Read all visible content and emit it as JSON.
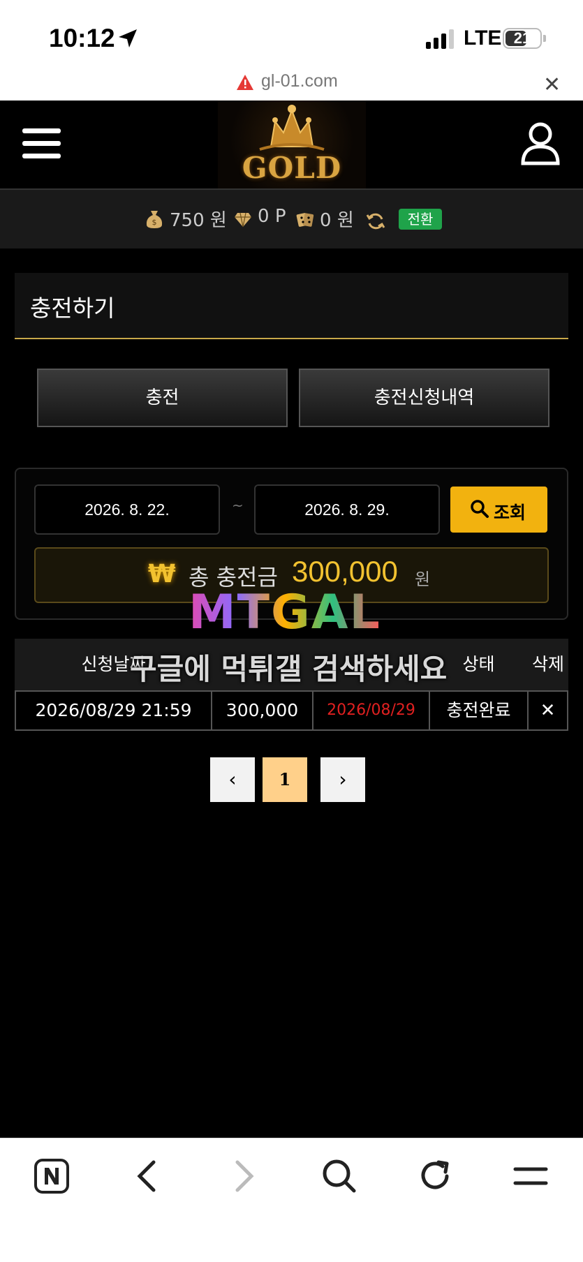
{
  "status_bar": {
    "time": "10:12",
    "network": "LTE",
    "battery": "21"
  },
  "url_bar": {
    "url": "gl-01.com"
  },
  "header": {
    "logo_text": "GOLD"
  },
  "balance": {
    "money_value": "750",
    "money_unit": "원",
    "point_value": "0",
    "point_unit": "P",
    "casino_value": "0",
    "casino_unit": "원",
    "convert_label": "전환"
  },
  "page": {
    "title": "충전하기"
  },
  "tabs": [
    {
      "label": "충전"
    },
    {
      "label": "충전신청내역"
    }
  ],
  "search": {
    "start_date": "2026. 8. 22.",
    "separator": "~",
    "end_date": "2026. 8. 29.",
    "button_label": "조회"
  },
  "total": {
    "icon": "₩",
    "label": "총 충전금",
    "amount": "300,000",
    "unit": "원"
  },
  "table": {
    "headers": [
      "신청날짜",
      "",
      "",
      "상태",
      "삭제"
    ],
    "rows": [
      {
        "date": "2026/08/29 21:59",
        "amount": "300,000",
        "process_date": "2026/08/29",
        "status": "충전완료",
        "delete": "✕"
      }
    ]
  },
  "watermark": {
    "logo": "MTGAL",
    "text": "구글에 먹튀갤 검색하세요"
  },
  "pagination": {
    "prev": "‹",
    "current": "1",
    "next": "›"
  },
  "colors": {
    "accent": "#f2b20f",
    "gold": "#c9a94a",
    "green": "#1fa34a",
    "red": "#e02020",
    "page_active": "#ffd08a"
  }
}
